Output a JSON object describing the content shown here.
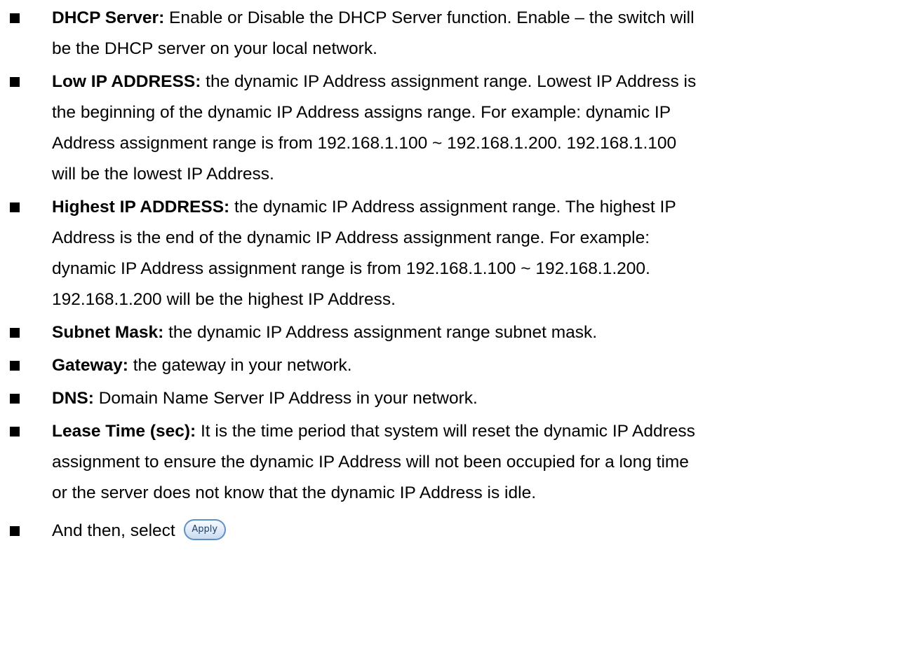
{
  "items": [
    {
      "term": "DHCP Server:",
      "lines": [
        " Enable or Disable the DHCP Server function. Enable – the switch will",
        "be the DHCP server on your local network."
      ]
    },
    {
      "term": "Low IP ADDRESS:",
      "lines": [
        " the dynamic IP Address assignment range. Lowest IP Address is",
        "the beginning of the dynamic IP Address assigns range. For example: dynamic IP",
        "Address assignment range is from 192.168.1.100 ~ 192.168.1.200. 192.168.1.100",
        "will be the lowest IP Address."
      ]
    },
    {
      "term": "Highest IP ADDRESS:",
      "lines": [
        " the dynamic IP Address assignment range. The highest IP",
        "Address is the end of the dynamic IP Address assignment range. For example:",
        "dynamic IP Address assignment range is from 192.168.1.100 ~ 192.168.1.200.",
        "192.168.1.200 will be the highest IP Address."
      ]
    },
    {
      "term": "Subnet Mask:",
      "lines": [
        " the dynamic IP Address assignment range subnet mask."
      ]
    },
    {
      "term": "Gateway:",
      "lines": [
        " the gateway in your network."
      ]
    },
    {
      "term": "DNS:",
      "lines": [
        " Domain Name Server IP Address in your network."
      ]
    },
    {
      "term": "Lease Time (sec):",
      "lines": [
        " It is the time period that system will reset the dynamic IP Address",
        "assignment to ensure the dynamic IP Address will not been occupied for a long time",
        "or the server does not know that the dynamic IP Address is idle."
      ]
    }
  ],
  "final_item": {
    "text": "And then, select",
    "button_label": "Apply"
  }
}
